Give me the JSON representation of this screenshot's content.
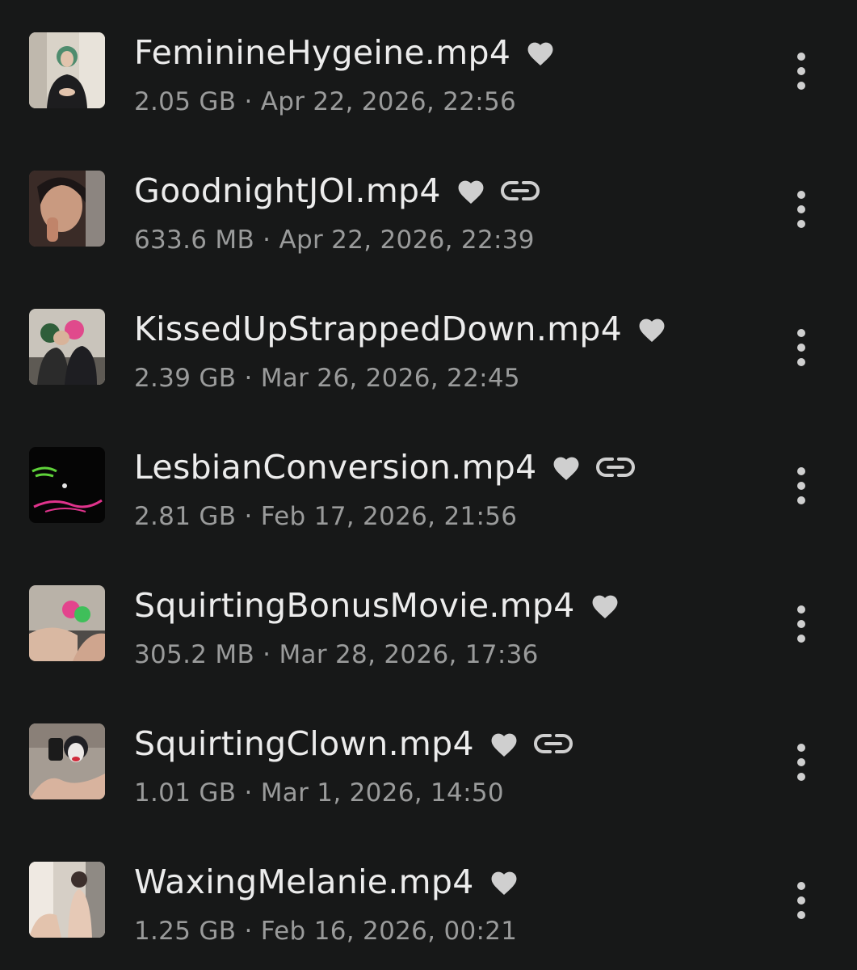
{
  "colors": {
    "background": "#171818",
    "primary_text": "#ececec",
    "secondary_text": "#9a9b9b",
    "icon": "#cfcfcf"
  },
  "icons": {
    "favorite": "heart-icon",
    "shared": "link-icon",
    "menu": "more-vertical-icon"
  },
  "files": [
    {
      "name": "FeminineHygeine.mp4",
      "size": "2.05 GB",
      "separator": "·",
      "date": "Apr 22, 2026, 22:56",
      "favorite": true,
      "shared": false,
      "thumbnail": "thumb-woman-green-hair-kitchen"
    },
    {
      "name": "GoodnightJOI.mp4",
      "size": "633.6 MB",
      "separator": "·",
      "date": "Apr 22, 2026, 22:39",
      "favorite": true,
      "shared": true,
      "thumbnail": "thumb-woman-closeup"
    },
    {
      "name": "KissedUpStrappedDown.mp4",
      "size": "2.39 GB",
      "separator": "·",
      "date": "Mar 26, 2026, 22:45",
      "favorite": true,
      "shared": false,
      "thumbnail": "thumb-two-women"
    },
    {
      "name": "LesbianConversion.mp4",
      "size": "2.81 GB",
      "separator": "·",
      "date": "Feb 17, 2026, 21:56",
      "favorite": true,
      "shared": true,
      "thumbnail": "thumb-title-card"
    },
    {
      "name": "SquirtingBonusMovie.mp4",
      "size": "305.2 MB",
      "separator": "·",
      "date": "Mar 28, 2026, 17:36",
      "favorite": true,
      "shared": false,
      "thumbnail": "thumb-bed-scene"
    },
    {
      "name": "SquirtingClown.mp4",
      "size": "1.01 GB",
      "separator": "·",
      "date": "Mar 1, 2026, 14:50",
      "favorite": true,
      "shared": true,
      "thumbnail": "thumb-clown-makeup"
    },
    {
      "name": "WaxingMelanie.mp4",
      "size": "1.25 GB",
      "separator": "·",
      "date": "Feb 16, 2026, 00:21",
      "favorite": true,
      "shared": false,
      "thumbnail": "thumb-room-scene"
    }
  ]
}
